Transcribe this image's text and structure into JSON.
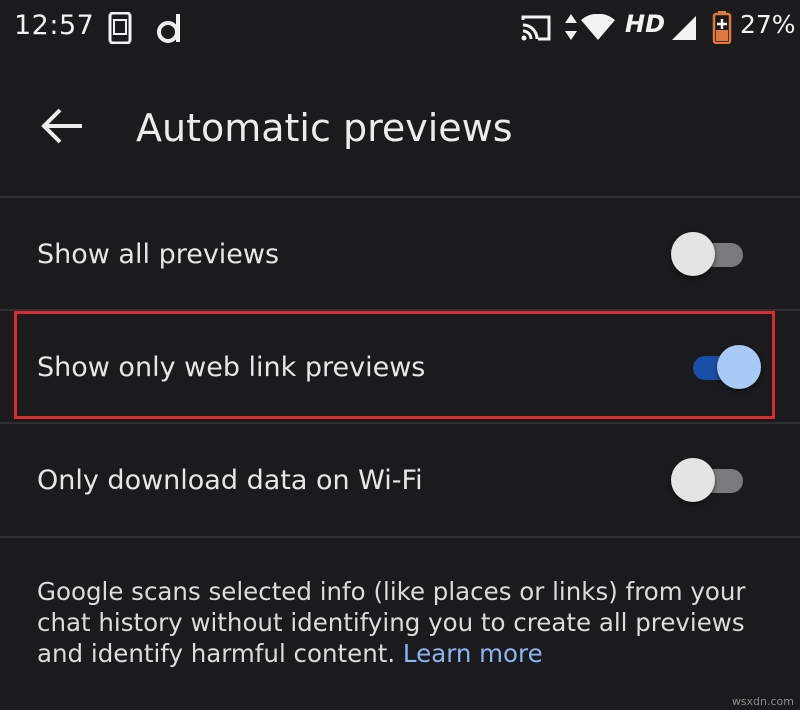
{
  "status_bar": {
    "time": "12:57",
    "network_label": "HD",
    "battery_percent": "27%",
    "icons": [
      "phone-screen-icon",
      "app-d-icon",
      "cast-icon",
      "data-arrows-icon",
      "wifi-icon",
      "signal-icon",
      "battery-charging-icon"
    ]
  },
  "app_bar": {
    "title": "Automatic previews",
    "back_icon": "back-arrow-icon"
  },
  "settings": [
    {
      "label": "Show all previews",
      "enabled": false
    },
    {
      "label": "Show only web link previews",
      "enabled": true
    },
    {
      "label": "Only download data on Wi-Fi",
      "enabled": false
    }
  ],
  "info": {
    "text": "Google scans selected info (like places or links) from your chat history without identifying you to create all previews and identify harmful content. ",
    "link_text": "Learn more"
  },
  "watermark": "wsxdn.com",
  "colors": {
    "background": "#1b1b1d",
    "toggle_on_track": "#1a4fa8",
    "toggle_on_thumb": "#a9c9f7",
    "toggle_off_track": "#7a7a7c",
    "toggle_off_thumb": "#e4e4e4",
    "link": "#8cb4f2",
    "highlight_border": "#d72a31",
    "battery_accent": "#e07a3c"
  }
}
